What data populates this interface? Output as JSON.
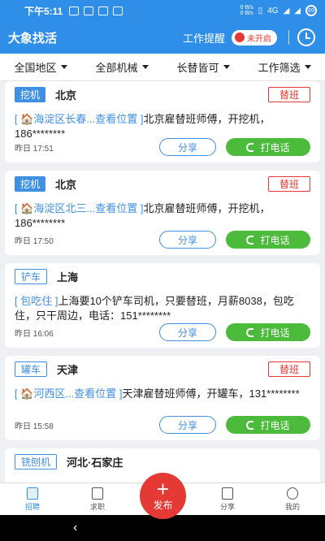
{
  "status_bar": {
    "time": "下午5:11",
    "network_speed_top": "0 B/s",
    "network_speed_bottom": "0 B/s",
    "signal": "4G",
    "battery": "69"
  },
  "header": {
    "title": "大象找活",
    "remind_label": "工作提醒",
    "toggle_label": "未开启"
  },
  "filters": [
    {
      "label": "全国地区"
    },
    {
      "label": "全部机械"
    },
    {
      "label": "长替皆可"
    },
    {
      "label": "工作筛选"
    }
  ],
  "share_label": "分享",
  "call_label": "打电话",
  "cards": [
    {
      "tag": "挖机",
      "city": "北京",
      "badge": "替班",
      "loc": "[ 🏠海淀区长春...查看位置 ]",
      "text": "北京雇替班师傅，开挖机，186********",
      "date": "昨日 17:51"
    },
    {
      "tag": "挖机",
      "city": "北京",
      "badge": "替班",
      "loc": "[ 🏠海淀区北三...查看位置 ]",
      "text": "北京雇替班师傅，开挖机，186********",
      "date": "昨日 17:50"
    },
    {
      "tag": "铲车",
      "city": "上海",
      "badge": "",
      "loc": "[ 包吃住 ]",
      "text": "上海要10个铲车司机，只要替班，月薪8038，包吃住，只干周边，电话：151********",
      "date": "昨日 16:06"
    },
    {
      "tag": "罐车",
      "city": "天津",
      "badge": "替班",
      "loc": "[ 🏠河西区...查看位置 ]",
      "text": "天津雇替班师傅，开罐车，131********",
      "date": "昨日 15:58"
    },
    {
      "tag": "铣刨机",
      "city": "河北·石家庄",
      "badge": "",
      "loc": "",
      "text": "",
      "date": ""
    }
  ],
  "bottom_nav": {
    "recruit": "招聘",
    "job": "求职",
    "publish": "发布",
    "share": "分享",
    "mine": "我的"
  }
}
